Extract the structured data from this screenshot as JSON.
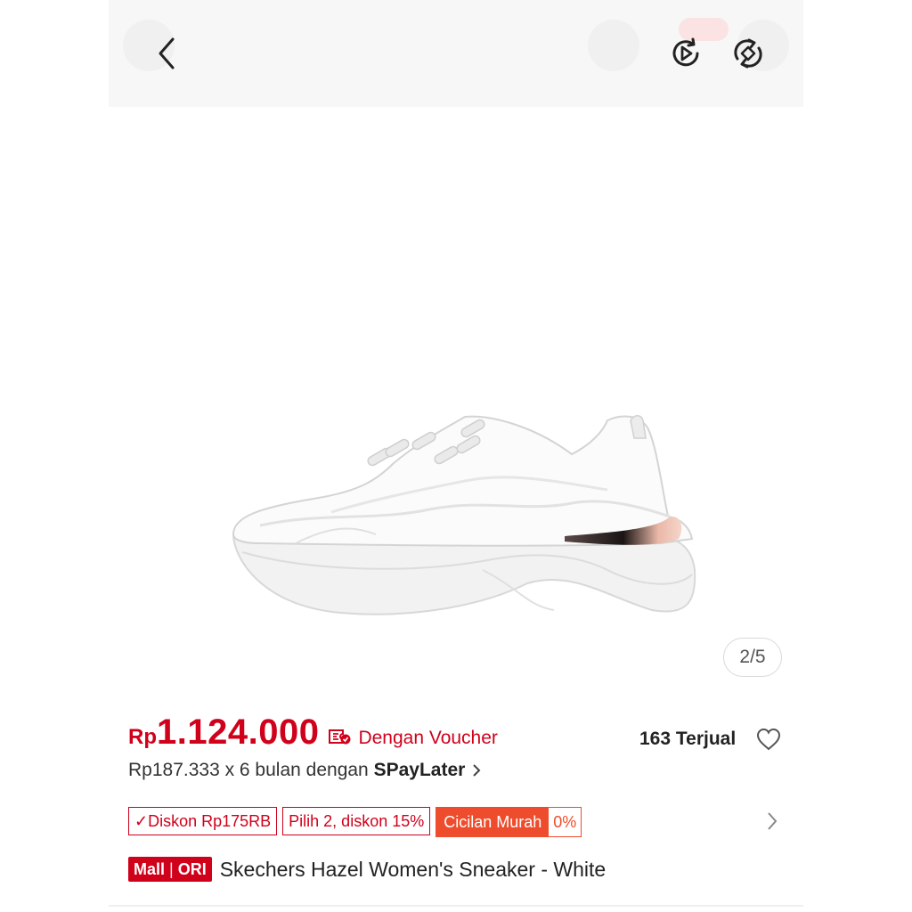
{
  "topbar": {
    "icons": {
      "back": "chevron-left-icon",
      "video": "video-play-icon",
      "ar": "rotate-view-icon"
    }
  },
  "product": {
    "image_description_icon": "sneaker-image",
    "page_indicator": "2/5",
    "price": {
      "currency": "Rp",
      "amount": "1.124.000",
      "voucher_label": "Dengan Voucher"
    },
    "sold": "163 Terjual",
    "installment": {
      "prefix": "Rp187.333 x 6 bulan dengan ",
      "brand": "SPayLater"
    },
    "tags": [
      {
        "label": "✓Diskon Rp175RB"
      },
      {
        "label": "Pilih 2, diskon 15%"
      }
    ],
    "promo_tag": {
      "label": "Cicilan Murah",
      "value": "0%"
    },
    "badge": {
      "mall": "Mall",
      "ori": "ORI"
    },
    "title": "Skechers Hazel Women's Sneaker - White"
  },
  "colors": {
    "brand_red": "#d0011b",
    "orange": "#ee4d2d"
  }
}
